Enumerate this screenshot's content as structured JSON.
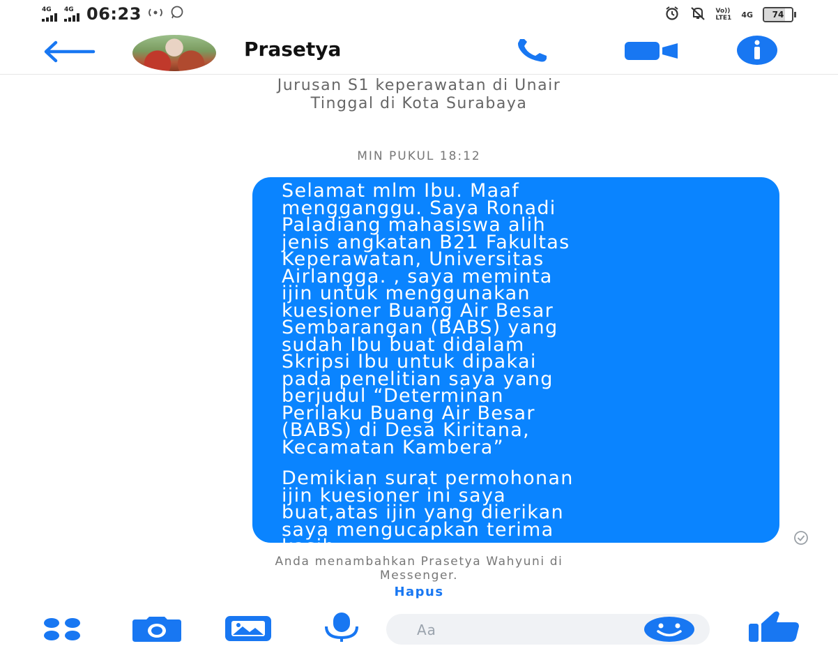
{
  "status_bar": {
    "network_1": "4G",
    "network_2": "4G",
    "time": "06:23",
    "volte_label": "Vo))",
    "lte_label": "LTE1",
    "network_right": "4G",
    "battery_level": 74,
    "battery_text": "74"
  },
  "header": {
    "contact_name": "Prasetya",
    "icons": [
      "back-arrow-icon",
      "phone-icon",
      "video-camera-icon",
      "info-icon"
    ]
  },
  "intro": {
    "line1": "Jurusan S1 keperawatan di Unair",
    "line2": "Tinggal di Kota Surabaya"
  },
  "conversation": {
    "timestamp": "MIN PUKUL 18:12",
    "message": {
      "paragraph1": "Selamat mlm Ibu. Maaf\nmengganggu. Saya Ronadi\nPaladiang mahasiswa alih\njenis angkatan B21 Fakultas\nKeperawatan, Universitas\nAirlangga. , saya meminta\nijin untuk menggunakan\nkuesioner Buang Air Besar\nSembarangan (BABS) yang\nsudah Ibu buat didalam\nSkripsi Ibu untuk dipakai\npada penelitian saya yang\nberjudul “Determinan\nPerilaku Buang Air Besar\n(BABS) di Desa Kiritana,\nKecamatan Kambera”",
      "paragraph2": "Demikian surat permohonan\nijin kuesioner ini saya\nbuat,atas ijin yang dierikan\nsaya mengucapkan terima\nkasih."
    },
    "system_note_line1": "Anda menambahkan Prasetya Wahyuni di",
    "system_note_line2": "Messenger.",
    "remove_link": "Hapus"
  },
  "composer": {
    "placeholder": "Aa",
    "value": "",
    "icons": [
      "apps-grid-icon",
      "camera-icon",
      "gallery-icon",
      "microphone-icon",
      "emoji-icon",
      "thumbs-up-icon"
    ]
  },
  "colors": {
    "accent": "#1877f2",
    "bubble": "#0a84ff",
    "muted_text": "#666666"
  }
}
